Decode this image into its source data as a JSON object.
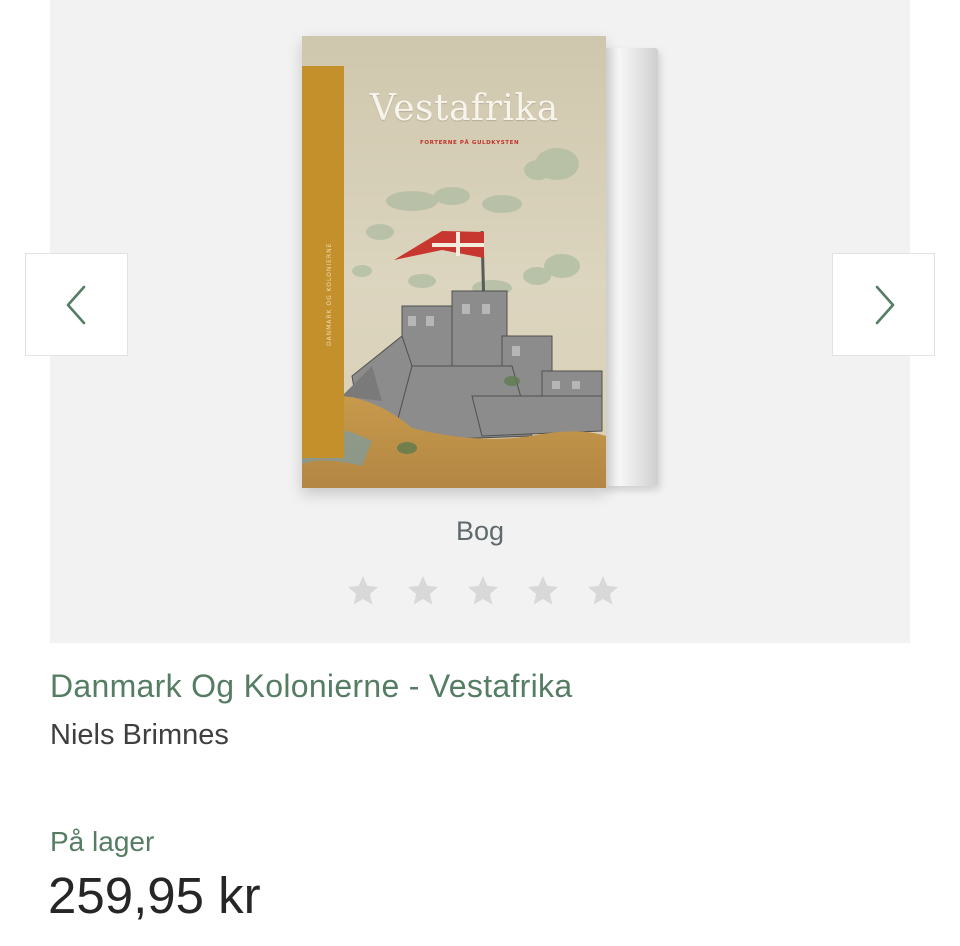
{
  "product": {
    "cover": {
      "title": "Vestafrika",
      "subtitle": "FORTERNE PÅ GULDKYSTEN",
      "spine_text": "DANMARK OG KOLONIERNE",
      "band_color": "#c3902c"
    },
    "format": "Bog",
    "rating": {
      "stars_total": 5,
      "stars_filled": 0
    },
    "title": "Danmark Og Kolonierne - Vestafrika",
    "author": "Niels Brimnes",
    "stock_status": "På lager",
    "price": "259,95 kr"
  },
  "carousel": {
    "prev_icon": "chevron-left-icon",
    "next_icon": "chevron-right-icon"
  },
  "colors": {
    "accent": "#557d63",
    "stage_bg": "#f2f2f2",
    "star_empty": "#d8d8d8"
  }
}
